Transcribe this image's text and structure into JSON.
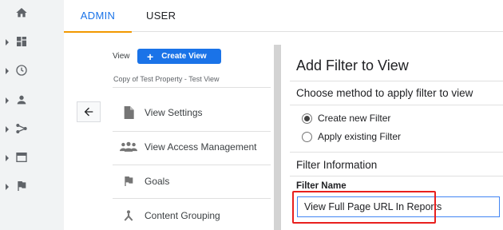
{
  "tabs": {
    "admin": "ADMIN",
    "user": "USER",
    "active": "admin"
  },
  "rail": {
    "items": [
      {
        "icon": "home-icon"
      },
      {
        "icon": "customization-icon"
      },
      {
        "icon": "realtime-clock-icon"
      },
      {
        "icon": "audience-person-icon"
      },
      {
        "icon": "acquisition-icon"
      },
      {
        "icon": "behavior-icon"
      },
      {
        "icon": "conversions-flag-icon"
      }
    ]
  },
  "view_panel": {
    "view_label": "View",
    "create_view_label": "Create View",
    "property_name": "Copy of Test Property - Test View",
    "nav_items": [
      {
        "label": "View Settings",
        "icon": "document-icon"
      },
      {
        "label": "View Access Management",
        "icon": "people-icon"
      },
      {
        "label": "Goals",
        "icon": "flag-icon"
      },
      {
        "label": "Content Grouping",
        "icon": "grouping-icon"
      }
    ]
  },
  "filter_panel": {
    "title": "Add Filter to View",
    "method_heading": "Choose method to apply filter to view",
    "options": [
      {
        "label": "Create new Filter",
        "selected": true
      },
      {
        "label": "Apply existing Filter",
        "selected": false
      }
    ],
    "info_heading": "Filter Information",
    "field_label": "Filter Name",
    "field_value": "View Full Page URL In Reports"
  },
  "colors": {
    "accent": "#1a73e8",
    "tab_underline": "#f29900",
    "highlight": "#e8201e",
    "rail_bg": "#f1f3f4"
  }
}
